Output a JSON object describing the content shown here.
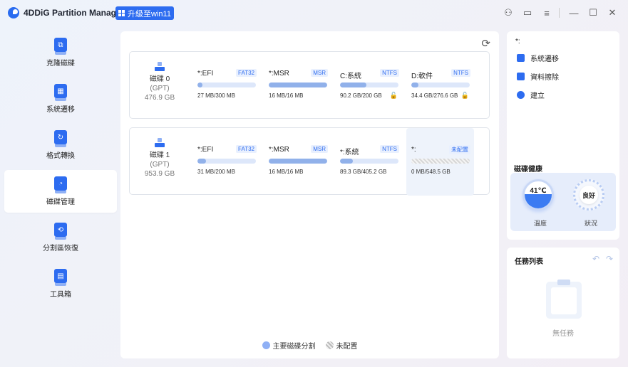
{
  "app": {
    "title": "4DDiG Partition Manager",
    "upgrade_label": "升級至win11"
  },
  "titlebar": {
    "icons": [
      "account-icon",
      "feedback-icon",
      "menu-icon",
      "minimize-icon",
      "maximize-icon",
      "close-icon"
    ],
    "glyphs": {
      "account": "⚇",
      "feedback": "▭",
      "menu": "≡",
      "minimize": "—",
      "maximize": "☐",
      "close": "✕"
    }
  },
  "sidebar": {
    "items": [
      {
        "label": "克隆磁碟",
        "icon": "clone-disk-icon",
        "active": false
      },
      {
        "label": "系統遷移",
        "icon": "system-migration-icon",
        "active": false
      },
      {
        "label": "格式轉換",
        "icon": "format-convert-icon",
        "active": false
      },
      {
        "label": "磁碟管理",
        "icon": "disk-management-icon",
        "active": true
      },
      {
        "label": "分割區恢復",
        "icon": "partition-recovery-icon",
        "active": false
      },
      {
        "label": "工具箱",
        "icon": "toolbox-icon",
        "active": false
      }
    ]
  },
  "disks": [
    {
      "name": "磁碟 0",
      "type": "(GPT)",
      "size": "476.9 GB",
      "partitions": [
        {
          "name": "*:EFI",
          "fs": "FAT32",
          "usage": "27 MB/300 MB",
          "fill": 0.09,
          "locked": false
        },
        {
          "name": "*:MSR",
          "fs": "MSR",
          "usage": "16 MB/16 MB",
          "fill": 1.0,
          "locked": false
        },
        {
          "name": "C:系統",
          "fs": "NTFS",
          "usage": "90.2 GB/200 GB",
          "fill": 0.45,
          "locked": true
        },
        {
          "name": "D:軟件",
          "fs": "NTFS",
          "usage": "34.4 GB/276.6 GB",
          "fill": 0.12,
          "locked": true
        }
      ]
    },
    {
      "name": "磁碟 1",
      "type": "(GPT)",
      "size": "953.9 GB",
      "partitions": [
        {
          "name": "*:EFI",
          "fs": "FAT32",
          "usage": "31 MB/200 MB",
          "fill": 0.15,
          "locked": false
        },
        {
          "name": "*:MSR",
          "fs": "MSR",
          "usage": "16 MB/16 MB",
          "fill": 1.0,
          "locked": false
        },
        {
          "name": "*:系統",
          "fs": "NTFS",
          "usage": "89.3 GB/405.2 GB",
          "fill": 0.22,
          "locked": false
        },
        {
          "name": "*:",
          "fs": "未配置",
          "usage": "0 MB/548.5 GB",
          "fill": 0,
          "locked": false,
          "unallocated": true
        }
      ]
    }
  ],
  "legend": {
    "primary": "主要磁碟分割",
    "unallocated": "未配置"
  },
  "side_panel": {
    "selected": "*:",
    "actions": [
      {
        "label": "系統遷移",
        "icon": "system-migration-icon"
      },
      {
        "label": "資料擦除",
        "icon": "eraser-icon"
      },
      {
        "label": "建立",
        "icon": "create-partition-icon"
      }
    ],
    "health_title": "磁碟健康",
    "temperature": "41℃",
    "temperature_label": "溫度",
    "status": "良好",
    "status_label": "狀況"
  },
  "tasks": {
    "title": "任務列表",
    "empty": "無任務",
    "undo": "↶",
    "redo": "↷"
  },
  "refresh": "⟳",
  "lock": "🔓"
}
